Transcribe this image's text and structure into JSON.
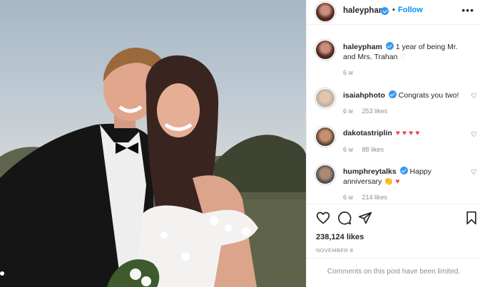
{
  "post": {
    "author": "haleypham",
    "follow_label": "Follow",
    "separator": "•",
    "more_icon": "more-horizontal-icon",
    "caption": {
      "username": "haleypham",
      "text": "1 year of being Mr. and Mrs. Trahan",
      "heart": "♡",
      "age": "6 w"
    },
    "comments": [
      {
        "username": "isaiahphoto",
        "text": "Congrats you two!",
        "age": "6 w",
        "likes": "253 likes"
      },
      {
        "username": "dakotastriplin",
        "text": "♥ ♥ ♥ ♥",
        "age": "6 w",
        "likes": "88 likes"
      },
      {
        "username": "humphreytalks",
        "text": "Happy anniversary",
        "emoji_clap": "👏",
        "emoji_heart": "♥",
        "age": "6 w",
        "likes": "214 likes"
      }
    ],
    "like_count": "238,124 likes",
    "date": "NOVEMBER 8",
    "comments_limited": "Comments on this post have been limited."
  },
  "colors": {
    "accent": "#0095f6",
    "verified": "#3897f0",
    "heart_red": "#ed4956",
    "muted_text": "#8e8e8e"
  }
}
